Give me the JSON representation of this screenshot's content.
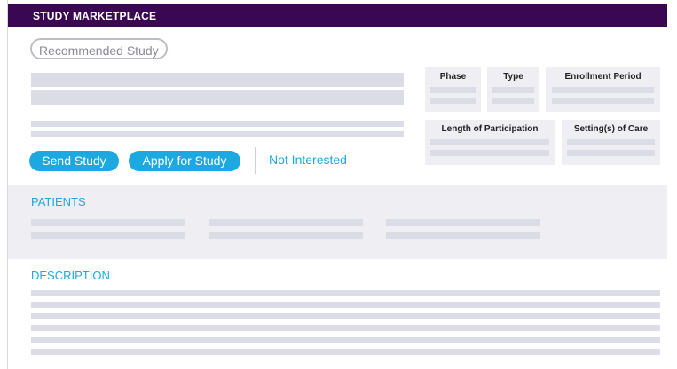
{
  "header": {
    "title": "STUDY MARKETPLACE"
  },
  "study": {
    "tag": "Recommended Study"
  },
  "meta": {
    "phase": "Phase",
    "type": "Type",
    "enrollment": "Enrollment Period",
    "length": "Length of Participation",
    "settings": "Setting(s) of Care"
  },
  "actions": {
    "send": "Send Study",
    "apply": "Apply for Study",
    "not_interested": "Not Interested"
  },
  "sections": {
    "patients": "PATIENTS",
    "description": "DESCRIPTION"
  },
  "colors": {
    "header_bg": "#3a0752",
    "accent": "#1ca8e0",
    "placeholder": "#dcdce6",
    "panel": "#eeeef3"
  }
}
